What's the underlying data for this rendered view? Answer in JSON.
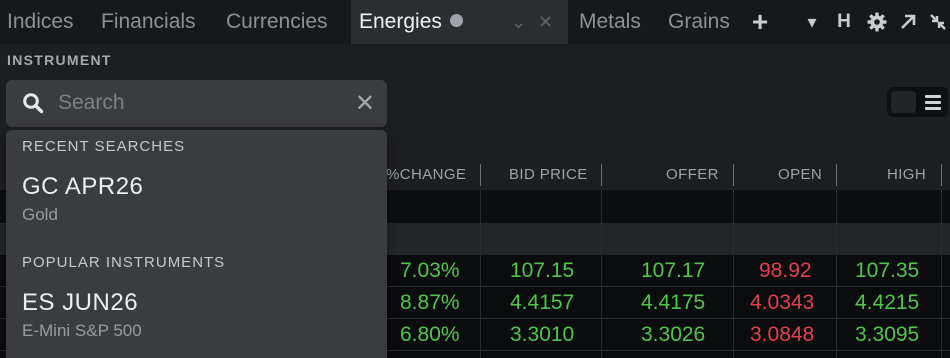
{
  "tabs": [
    {
      "label": "Indices",
      "active": false
    },
    {
      "label": "Financials",
      "active": false
    },
    {
      "label": "Currencies",
      "active": false
    },
    {
      "label": "Energies",
      "active": true
    },
    {
      "label": "Metals",
      "active": false
    },
    {
      "label": "Grains",
      "active": false
    }
  ],
  "tab_controls": {
    "chevron": "⌄",
    "close": "✕"
  },
  "toolbar": {
    "add": "+",
    "dropdown": "▾",
    "h_label": "H",
    "gear_icon": "gear-icon",
    "popout_icon": "popout-icon",
    "collapse_icon": "collapse-icon"
  },
  "instrument": {
    "label": "INSTRUMENT",
    "search_placeholder": "Search",
    "clear": "✕"
  },
  "dropdown": {
    "recent_label": "RECENT SEARCHES",
    "recent": [
      {
        "symbol": "GC APR26",
        "name": "Gold"
      }
    ],
    "popular_label": "POPULAR INSTRUMENTS",
    "popular": [
      {
        "symbol": "ES JUN26",
        "name": "E-Mini S&P 500"
      }
    ]
  },
  "table": {
    "columns": [
      "%CHANGE",
      "BID PRICE",
      "OFFER",
      "OPEN",
      "HIGH"
    ],
    "rows": [
      {
        "change": "7.03%",
        "bid": "107.15",
        "offer": "107.17",
        "open": "98.92",
        "high": "107.35"
      },
      {
        "change": "8.87%",
        "bid": "4.4157",
        "offer": "4.4175",
        "open": "4.0343",
        "high": "4.4215"
      },
      {
        "change": "6.80%",
        "bid": "3.3010",
        "offer": "3.3026",
        "open": "3.0848",
        "high": "3.3095"
      }
    ]
  },
  "colors": {
    "up": "#4fc64a",
    "down": "#e33f52",
    "active_tab": "#2b2d30"
  }
}
